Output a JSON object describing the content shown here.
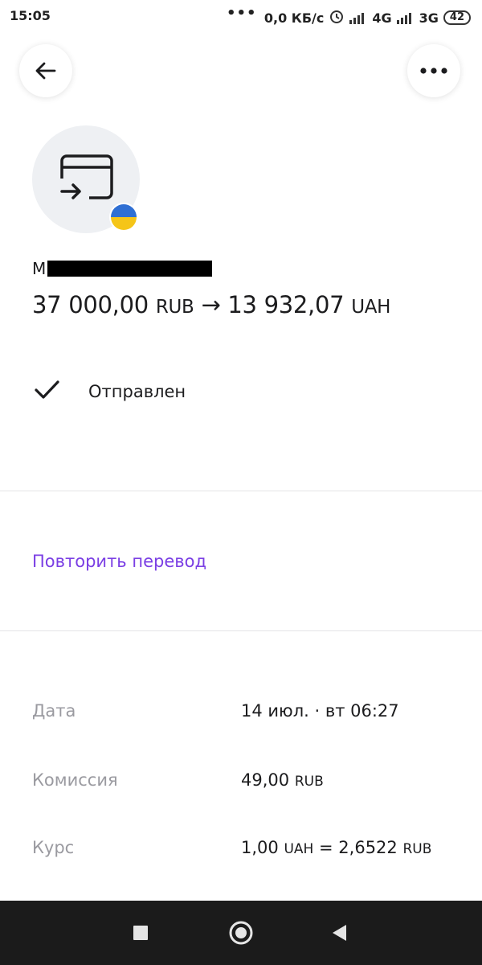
{
  "status_bar": {
    "time": "15:05",
    "dots": "•••",
    "speed": "0,0 КБ/с",
    "net1": "4G",
    "net2": "3G",
    "battery": "42"
  },
  "header": {
    "back_icon": "arrow-left-icon",
    "more_icon": "more-horizontal-icon"
  },
  "transfer": {
    "recipient_initial": "М",
    "amount_from": "37 000,00",
    "currency_from": "RUB",
    "arrow": "→",
    "amount_to": "13 932,07",
    "currency_to": "UAH",
    "flag_colors": {
      "top": "#2f6fd3",
      "bottom": "#f5c518"
    }
  },
  "status": {
    "text": "Отправлен",
    "icon": "check-icon"
  },
  "actions": {
    "repeat_label": "Повторить перевод",
    "accent_color": "#7b3fe4"
  },
  "details": {
    "date_label": "Дата",
    "date_value": "14 июл. · вт 06:27",
    "fee_label": "Комиссия",
    "fee_amount": "49,00",
    "fee_currency": "RUB",
    "rate_label": "Курс",
    "rate_left": "1,00",
    "rate_left_cur": "UAH",
    "rate_eq": "=",
    "rate_right": "2,6522",
    "rate_right_cur": "RUB"
  },
  "nav": {
    "recents": "square-icon",
    "home": "circle-icon",
    "back": "triangle-back-icon"
  }
}
